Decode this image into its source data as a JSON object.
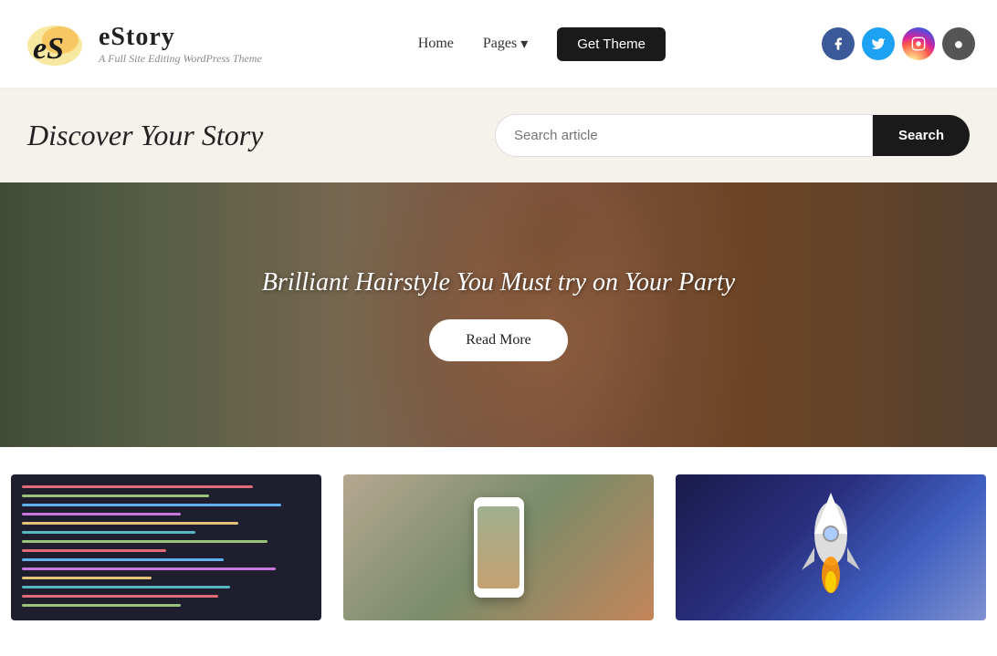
{
  "header": {
    "logo_title": "eStory",
    "logo_subtitle": "A Full Site Editing WordPress Theme",
    "nav": {
      "home": "Home",
      "pages": "Pages",
      "pages_has_dropdown": true,
      "get_theme": "Get Theme"
    },
    "social": [
      {
        "name": "facebook",
        "symbol": "f"
      },
      {
        "name": "twitter",
        "symbol": "𝕏"
      },
      {
        "name": "instagram",
        "symbol": "◎"
      },
      {
        "name": "more",
        "symbol": "●"
      }
    ]
  },
  "search_band": {
    "title": "Discover Your Story",
    "search_placeholder": "Search article",
    "search_button": "Search"
  },
  "hero": {
    "title": "Brilliant Hairstyle You Must try on Your Party",
    "read_more": "Read More"
  },
  "cards": [
    {
      "type": "code",
      "alt": "Code screenshot"
    },
    {
      "type": "phone",
      "alt": "Person holding phone with eStory app"
    },
    {
      "type": "rocket",
      "alt": "Rocket launching into space"
    }
  ]
}
